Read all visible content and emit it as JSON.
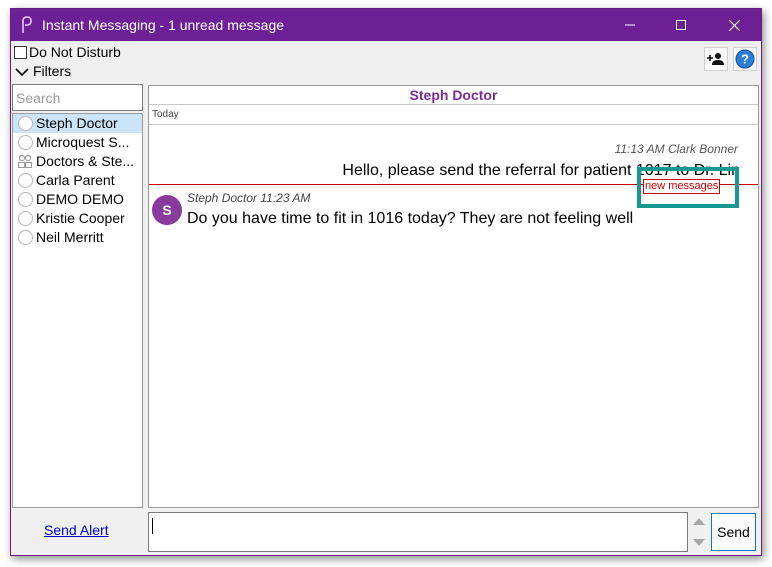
{
  "window": {
    "title": "Instant Messaging - 1 unread message",
    "accent": "#6d1f96"
  },
  "toolbar": {
    "do_not_disturb_label": "Do Not Disturb",
    "do_not_disturb_checked": false,
    "filters_label": "Filters",
    "add_contact_icon": "add-user-icon",
    "help_icon": "help-icon"
  },
  "search": {
    "placeholder": "Search",
    "value": ""
  },
  "contacts": [
    {
      "name": "Steph Doctor",
      "selected": true,
      "type": "user"
    },
    {
      "name": "Microquest S...",
      "selected": false,
      "type": "user"
    },
    {
      "name": "Doctors & Ste...",
      "selected": false,
      "type": "group"
    },
    {
      "name": "Carla Parent",
      "selected": false,
      "type": "user"
    },
    {
      "name": "DEMO DEMO",
      "selected": false,
      "type": "user"
    },
    {
      "name": "Kristie Cooper",
      "selected": false,
      "type": "user"
    },
    {
      "name": "Neil Merritt",
      "selected": false,
      "type": "user"
    }
  ],
  "chat": {
    "header": "Steph Doctor",
    "day_separator": "Today",
    "messages": [
      {
        "direction": "outgoing",
        "time": "11:13 AM",
        "sender": "Clark Bonner",
        "meta": "11:13 AM Clark Bonner",
        "text": "Hello, please send the referral for patient 1017 to Dr. Lin"
      },
      {
        "direction": "incoming",
        "time": "11:23 AM",
        "sender": "Steph Doctor",
        "meta": "Steph Doctor  11:23 AM",
        "avatar_letter": "S",
        "text": "Do you have time to fit in 1016 today? They are not feeling well"
      }
    ],
    "new_messages_label": "new messages",
    "highlight_color": "#159a93"
  },
  "footer": {
    "send_alert_label": "Send Alert",
    "compose_value": "",
    "send_label": "Send"
  }
}
